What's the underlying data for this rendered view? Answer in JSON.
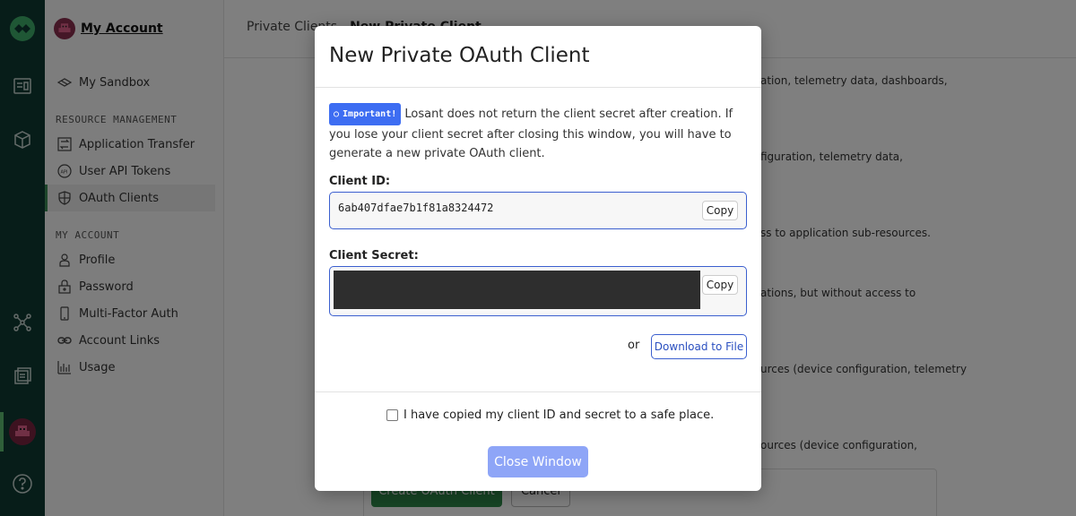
{
  "sidebar": {
    "account_name": "My Account",
    "sandbox": "My Sandbox",
    "resource_heading": "RESOURCE MANAGEMENT",
    "resource_items": [
      "Application Transfer",
      "User API Tokens",
      "OAuth Clients"
    ],
    "account_heading": "MY ACCOUNT",
    "account_items": [
      "Profile",
      "Password",
      "Multi-Factor Auth",
      "Account Links",
      "Usage"
    ]
  },
  "main": {
    "breadcrumb_parent": "Private Clients",
    "breadcrumb_current": "New Private Client",
    "bg_lines": [
      "ation, telemetry data, dashboards,",
      "figuration, telemetry data,",
      "ss to application sub-resources.",
      "ations, but without access to",
      "urces (device configuration, telemetry",
      "ources (device configuration,"
    ],
    "create_button": "Create OAuth Client",
    "cancel_button": "Cancel"
  },
  "modal": {
    "title": "New Private OAuth Client",
    "badge": "Important!",
    "notice": "Losant does not return the client secret after creation. If you lose your client secret after closing this window, you will have to generate a new private OAuth client.",
    "client_id_label": "Client ID:",
    "client_id_value": "6ab407dfae7b1f81a8324472",
    "client_secret_label": "Client Secret:",
    "copy_label": "Copy",
    "or_text": "or",
    "download_button": "Download to File",
    "confirm_text": "I have copied my client ID and secret to a safe place.",
    "close_button": "Close Window"
  },
  "colors": {
    "rail_bg": "#0e3b33",
    "accent_blue": "#3b5fcf",
    "badge_blue": "#3d6df2",
    "close_button": "#8ea5f7",
    "create_green": "#2f8a4a"
  }
}
